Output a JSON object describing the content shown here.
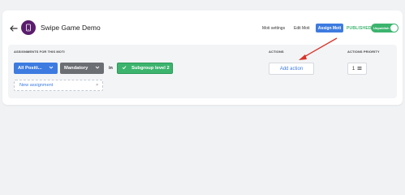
{
  "header": {
    "back_icon": "arrow-left-icon",
    "app_icon": "phone-icon",
    "app_icon_color": "#5a1d6d",
    "title": "Swipe Game Demo",
    "moti_settings": "Moti settings",
    "edit_moti": "Edit Moti",
    "assign_moti": "Assign Moti",
    "status": "PUBLISHED",
    "toggle_label": "Unpublish",
    "colors": {
      "accent": "#3d7be0",
      "success": "#3cb46e",
      "mandatory": "#6b6e73"
    }
  },
  "columns": {
    "assignments": "ASSIGNMENTS FOR THIS MOTI",
    "actions": "ACTIONS",
    "priority": "ACTIONS PRIORITY"
  },
  "assignment": {
    "positions": "All Positi...",
    "mandatory": "Mandatory",
    "in_label": "in",
    "subgroup": "Subgroup level 2",
    "new_assignment": "New assignment",
    "new_assignment_caret": "×"
  },
  "actions": {
    "add_action": "Add action",
    "priority_value": "1",
    "priority_icon": "menu-icon"
  },
  "annotation": {
    "icon": "red-arrow-pointer",
    "color": "#d9342b"
  }
}
